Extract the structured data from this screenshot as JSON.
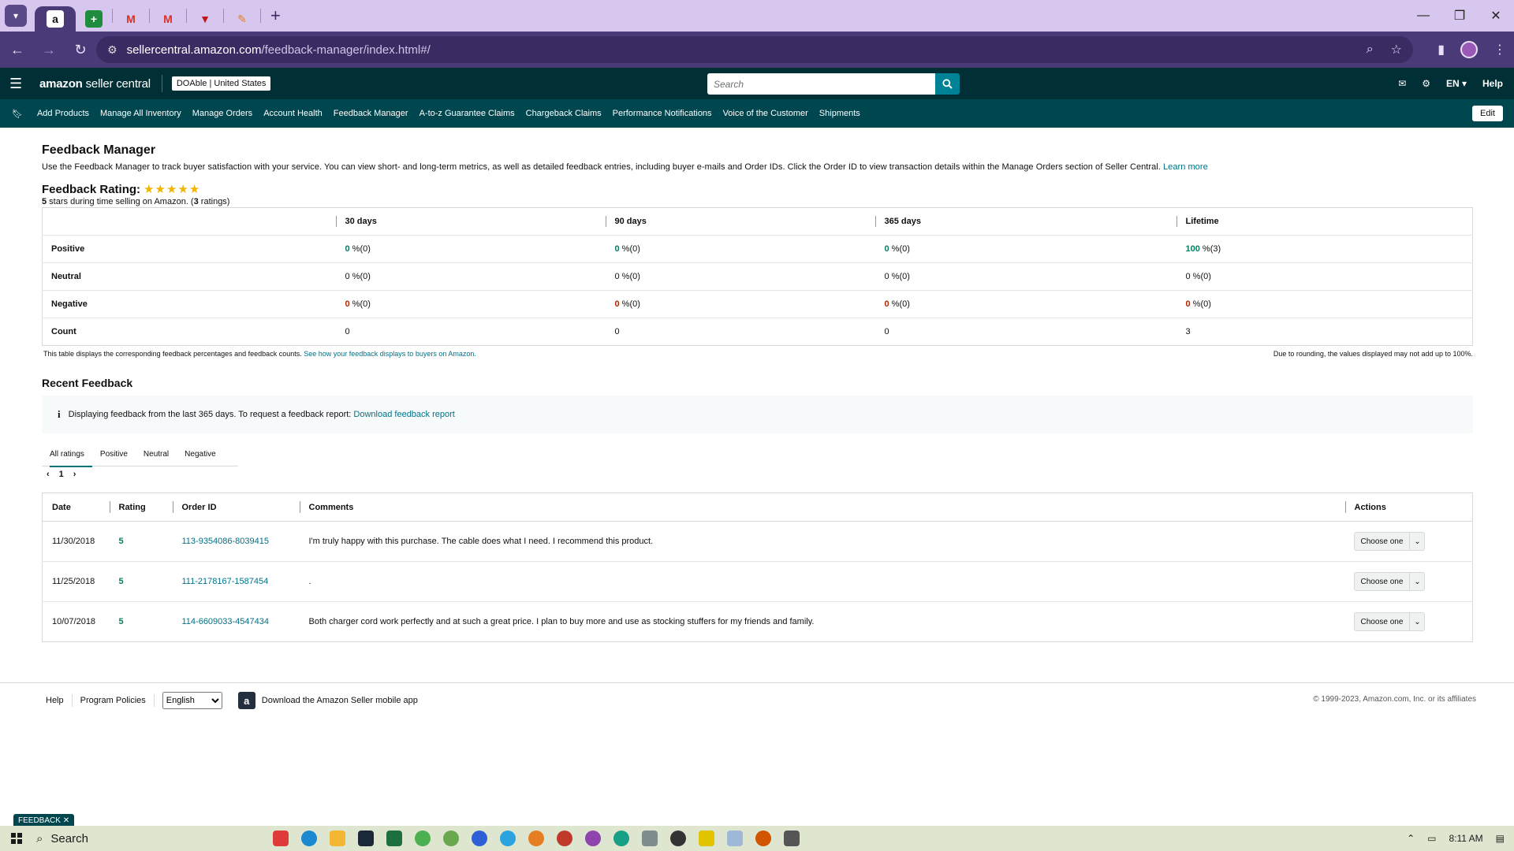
{
  "browser": {
    "url_host": "sellercentral.amazon.com",
    "url_path": "/feedback-manager/index.html#/"
  },
  "header": {
    "logo_main": "amazon",
    "logo_sub": "seller central",
    "account_name": "DOAble",
    "account_region": "United States",
    "search_placeholder": "Search",
    "lang": "EN",
    "help": "Help"
  },
  "nav": {
    "items": [
      "Add Products",
      "Manage All Inventory",
      "Manage Orders",
      "Account Health",
      "Feedback Manager",
      "A-to-z Guarantee Claims",
      "Chargeback Claims",
      "Performance Notifications",
      "Voice of the Customer",
      "Shipments"
    ],
    "edit_label": "Edit"
  },
  "page": {
    "title": "Feedback Manager",
    "intro": "Use the Feedback Manager to track buyer satisfaction with your service. You can view short- and long-term metrics, as well as detailed feedback entries, including buyer e-mails and Order IDs. Click the Order ID to view transaction details within the Manage Orders section of Seller Central.",
    "learn_more": "Learn more",
    "rating_label": "Feedback Rating:",
    "stars": 5,
    "rating_stars_num": "5",
    "rating_sub_mid": " stars during time selling on Amazon. (",
    "rating_count": "3",
    "rating_sub_end": " ratings)"
  },
  "stats": {
    "columns": [
      "30 days",
      "90 days",
      "365 days",
      "Lifetime"
    ],
    "rows": [
      {
        "label": "Positive",
        "kind": "g",
        "values": [
          [
            "0",
            " %(0)"
          ],
          [
            "0",
            " %(0)"
          ],
          [
            "0",
            " %(0)"
          ],
          [
            "100",
            " %(3)"
          ]
        ]
      },
      {
        "label": "Neutral",
        "kind": "",
        "values": [
          [
            "0",
            " %(0)"
          ],
          [
            "0",
            " %(0)"
          ],
          [
            "0",
            " %(0)"
          ],
          [
            "0",
            " %(0)"
          ]
        ]
      },
      {
        "label": "Negative",
        "kind": "r",
        "values": [
          [
            "0",
            " %(0)"
          ],
          [
            "0",
            " %(0)"
          ],
          [
            "0",
            " %(0)"
          ],
          [
            "0",
            " %(0)"
          ]
        ]
      },
      {
        "label": "Count",
        "kind": "",
        "values": [
          [
            "0",
            ""
          ],
          [
            "0",
            ""
          ],
          [
            "0",
            ""
          ],
          [
            "3",
            ""
          ]
        ]
      }
    ],
    "note_left": "This table displays the corresponding feedback percentages and feedback counts.",
    "note_left_link": "See how your feedback displays to buyers on Amazon.",
    "note_right": "Due to rounding, the values displayed may not add up to 100%."
  },
  "recent": {
    "title": "Recent Feedback",
    "info_text": "Displaying feedback from the last 365 days. To request a feedback report:",
    "info_link": "Download feedback report",
    "tabs": [
      "All ratings",
      "Positive",
      "Neutral",
      "Negative"
    ],
    "page": "1",
    "columns": [
      "Date",
      "Rating",
      "Order ID",
      "Comments",
      "Actions"
    ],
    "rows": [
      {
        "date": "11/30/2018",
        "rating": "5",
        "order_id": "113-9354086-8039415",
        "comment": "I'm truly happy with this purchase. The cable does what I need. I recommend this product.",
        "action": "Choose one"
      },
      {
        "date": "11/25/2018",
        "rating": "5",
        "order_id": "111-2178167-1587454",
        "comment": ".",
        "action": "Choose one"
      },
      {
        "date": "10/07/2018",
        "rating": "5",
        "order_id": "114-6609033-4547434",
        "comment": "Both charger cord work perfectly and at such a great price. I plan to buy more and use as stocking stuffers for my friends and family.",
        "action": "Choose one"
      }
    ]
  },
  "footer": {
    "help": "Help",
    "policies": "Program Policies",
    "language": "English",
    "app_text": "Download the Amazon Seller mobile app",
    "copyright": "© 1999-2023, Amazon.com, Inc. or its affiliates"
  },
  "feedback_tag": "FEEDBACK",
  "taskbar": {
    "search": "Search",
    "time": "8:11 AM"
  },
  "colors": {
    "header": "#002f36",
    "nav": "#00464f",
    "link": "#007185",
    "positive": "#067d62",
    "negative": "#b12704",
    "star": "#f1b400"
  }
}
